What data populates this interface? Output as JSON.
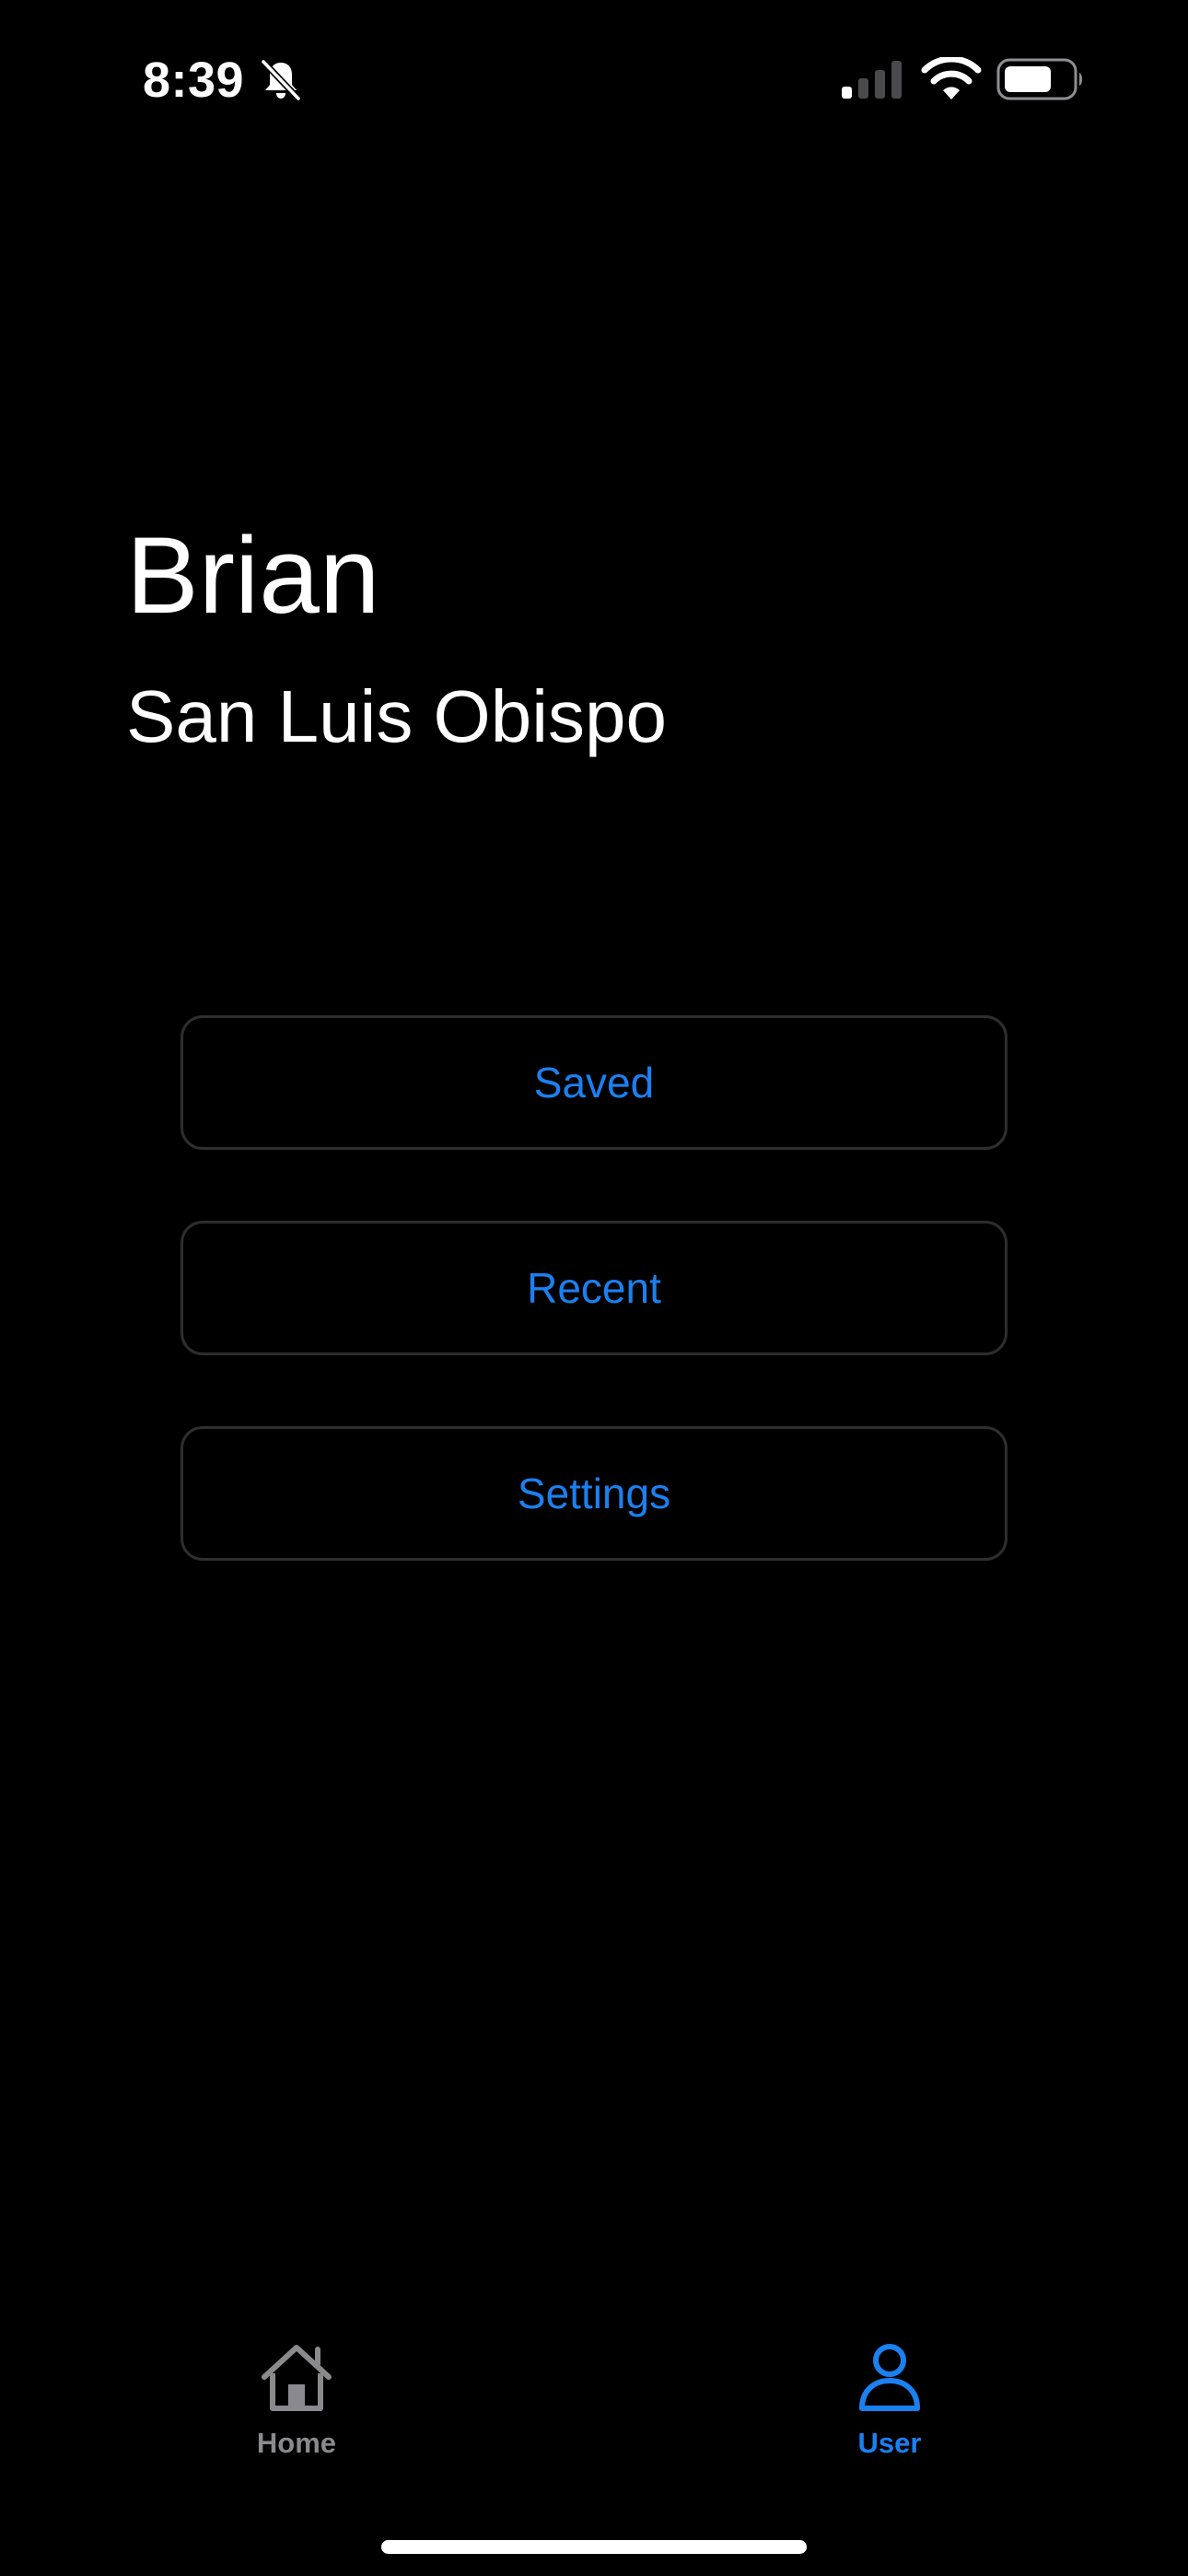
{
  "status_bar": {
    "time": "8:39",
    "icons": [
      "bell-slash-icon",
      "cellular-signal-icon",
      "wifi-icon",
      "battery-icon"
    ]
  },
  "profile": {
    "name": "Brian",
    "location": "San Luis Obispo"
  },
  "menu": {
    "saved_label": "Saved",
    "recent_label": "Recent",
    "settings_label": "Settings"
  },
  "tab_bar": {
    "home_label": "Home",
    "user_label": "User",
    "active_tab": "User"
  },
  "colors": {
    "background": "#000000",
    "accent": "#1b80f0",
    "inactive_tab": "#8a8a8e",
    "button_border": "#2e2e30"
  }
}
